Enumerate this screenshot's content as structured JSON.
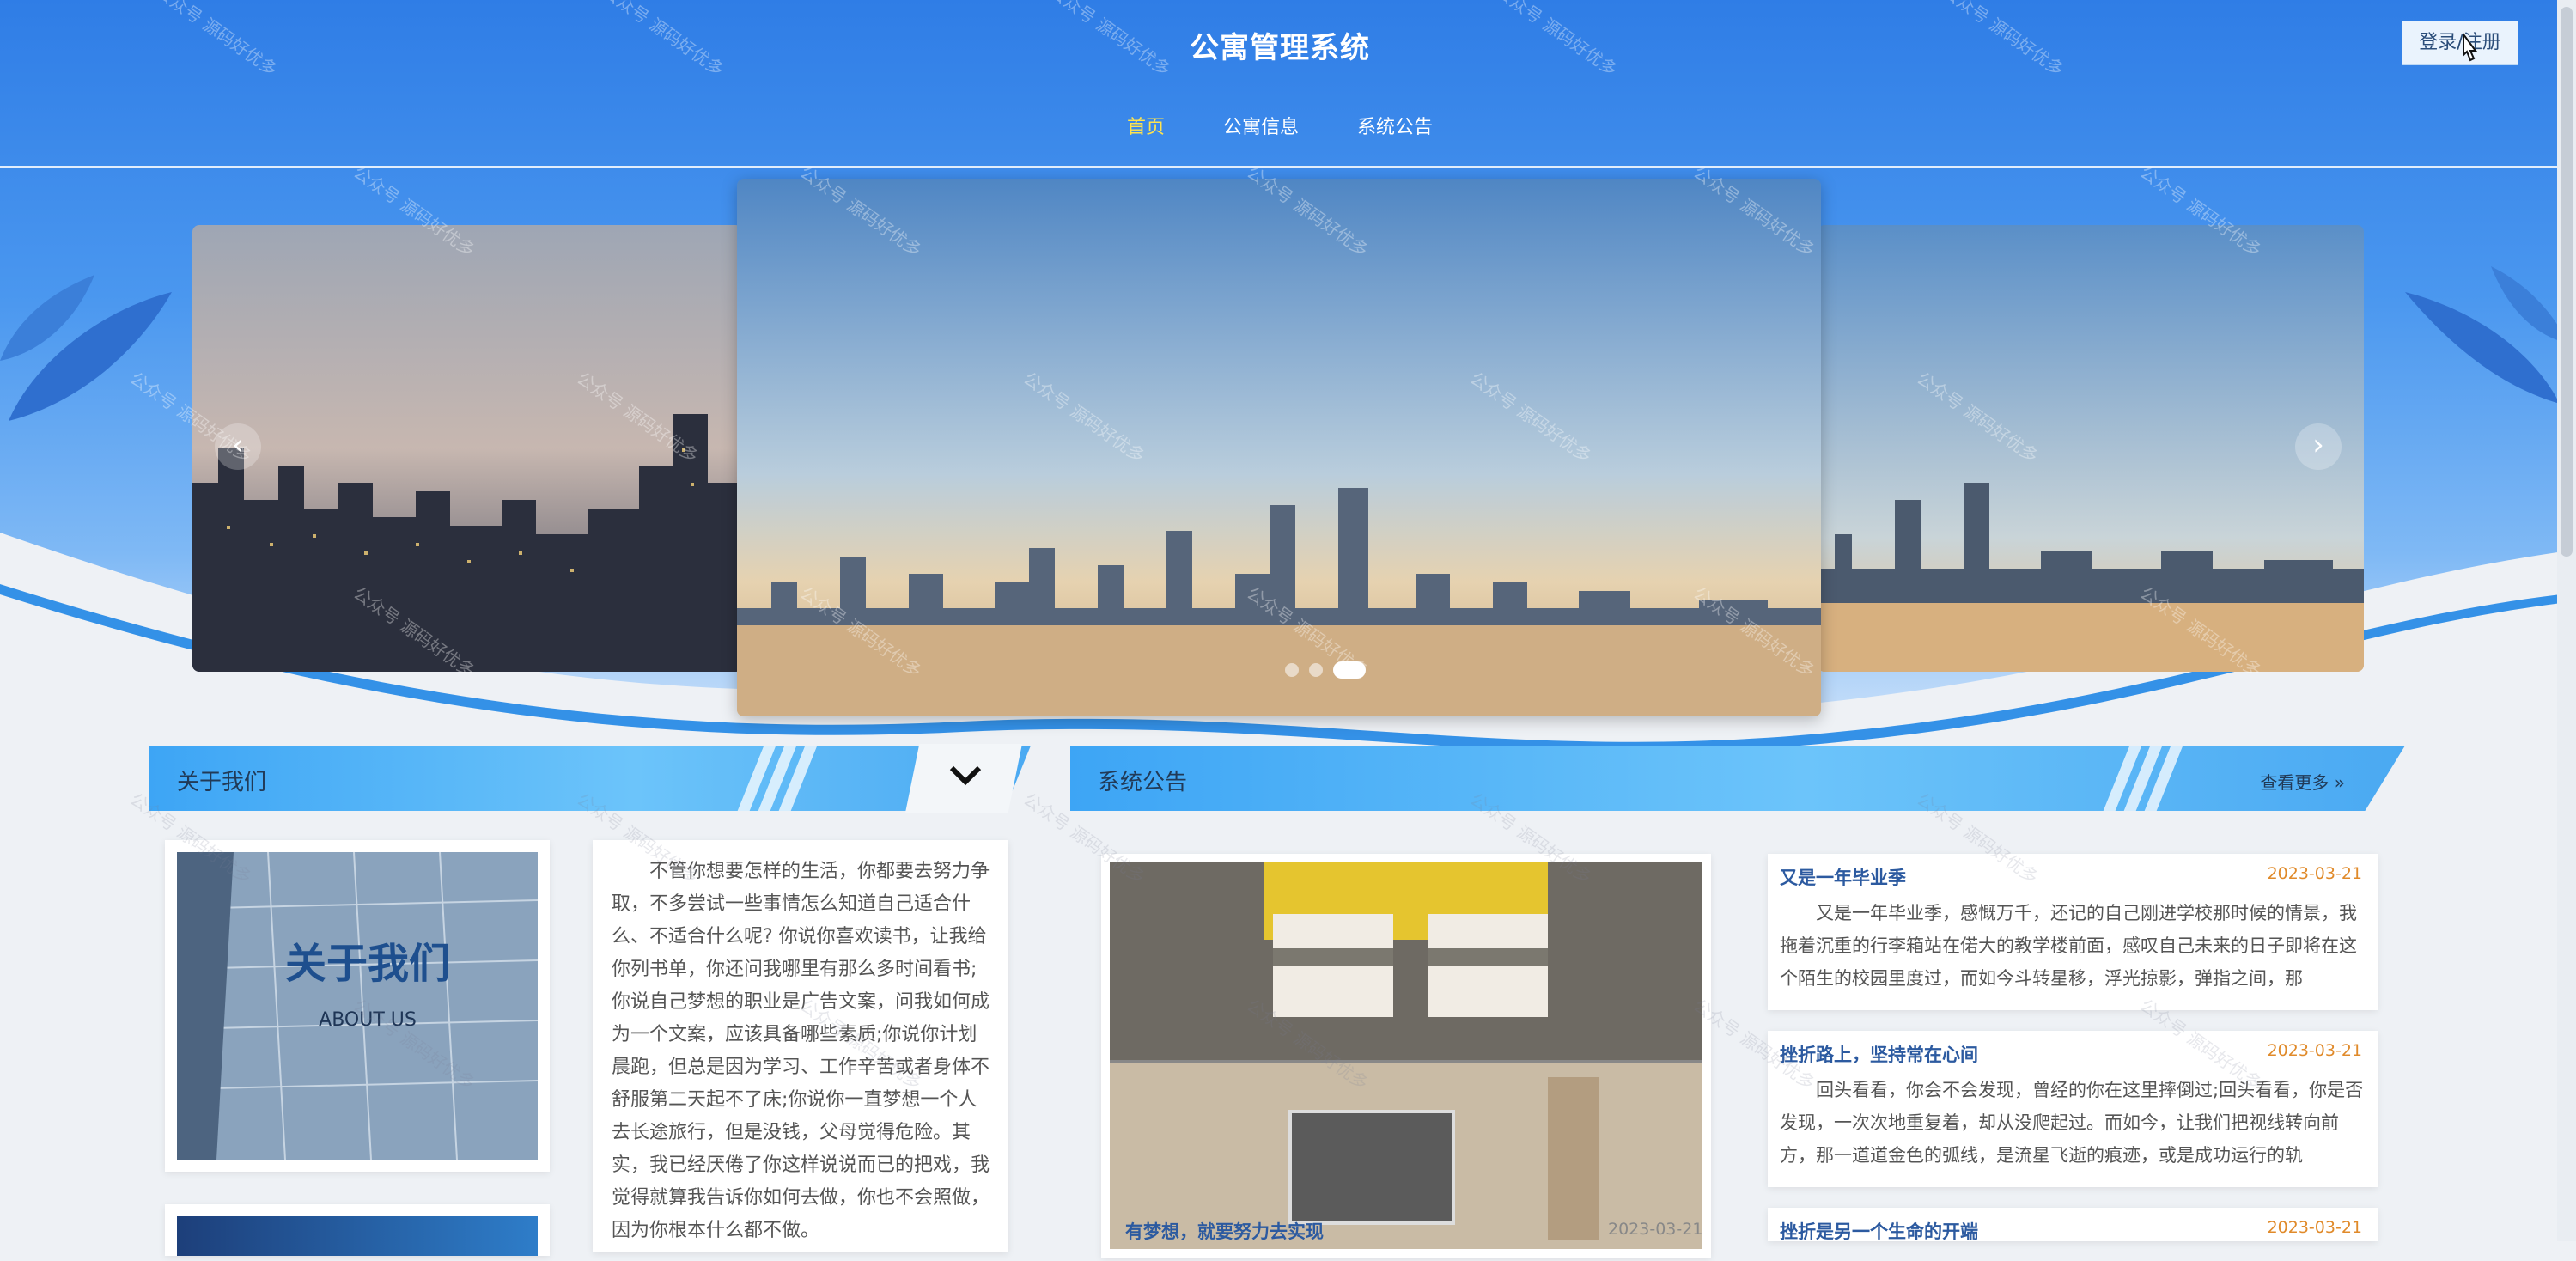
{
  "header": {
    "site_title": "公寓管理系统",
    "login_label": "登录/注册"
  },
  "nav": {
    "items": [
      "首页",
      "公寓信息",
      "系统公告"
    ],
    "active_index": 0
  },
  "carousel": {
    "prev_symbol": "‹",
    "next_symbol": "›",
    "dot_count": 3,
    "active_dot": 2
  },
  "about": {
    "title": "关于我们",
    "toggle_symbol": "⌄",
    "image_text": "关于我们",
    "image_subtext": "ABOUT US",
    "body": "不管你想要怎样的生活，你都要去努力争取，不多尝试一些事情怎么知道自己适合什么、不适合什么呢? 你说你喜欢读书，让我给你列书单，你还问我哪里有那么多时间看书;你说自己梦想的职业是广告文案，问我如何成为一个文案，应该具备哪些素质;你说你计划晨跑，但总是因为学习、工作辛苦或者身体不舒服第二天起不了床;你说你一直梦想一个人去长途旅行，但是没钱，父母觉得危险。其实，我已经厌倦了你这样说说而已的把戏，我觉得就算我告诉你如何去做，你也不会照做，因为你根本什么都不做。"
  },
  "notices": {
    "title": "系统公告",
    "more_label": "查看更多 »",
    "featured": {
      "caption": "有梦想，就要努力去实现",
      "date": "2023-03-21"
    },
    "items": [
      {
        "title": "又是一年毕业季",
        "date": "2023-03-21",
        "body": "又是一年毕业季，感慨万千，还记的自己刚进学校那时候的情景，我拖着沉重的行李箱站在偌大的教学楼前面，感叹自己未来的日子即将在这个陌生的校园里度过，而如今斗转星移，浮光掠影，弹指之间，那"
      },
      {
        "title": "挫折路上，坚持常在心间",
        "date": "2023-03-21",
        "body": "回头看看，你会不会发现，曾经的你在这里摔倒过;回头看看，你是否发现，一次次地重复着，却从没爬起过。而如今，让我们把视线转向前方，那一道道金色的弧线，是流星飞逝的痕迹，或是成功运行的轨"
      },
      {
        "title": "挫折是另一个生命的开端",
        "date": "2023-03-21",
        "body": ""
      }
    ]
  },
  "watermark": "公众号 源码好优多",
  "colors": {
    "primary_blue": "#3a8cee",
    "nav_active": "#ffe34d",
    "notice_title": "#2c5aa0",
    "notice_date": "#e08a2a"
  }
}
